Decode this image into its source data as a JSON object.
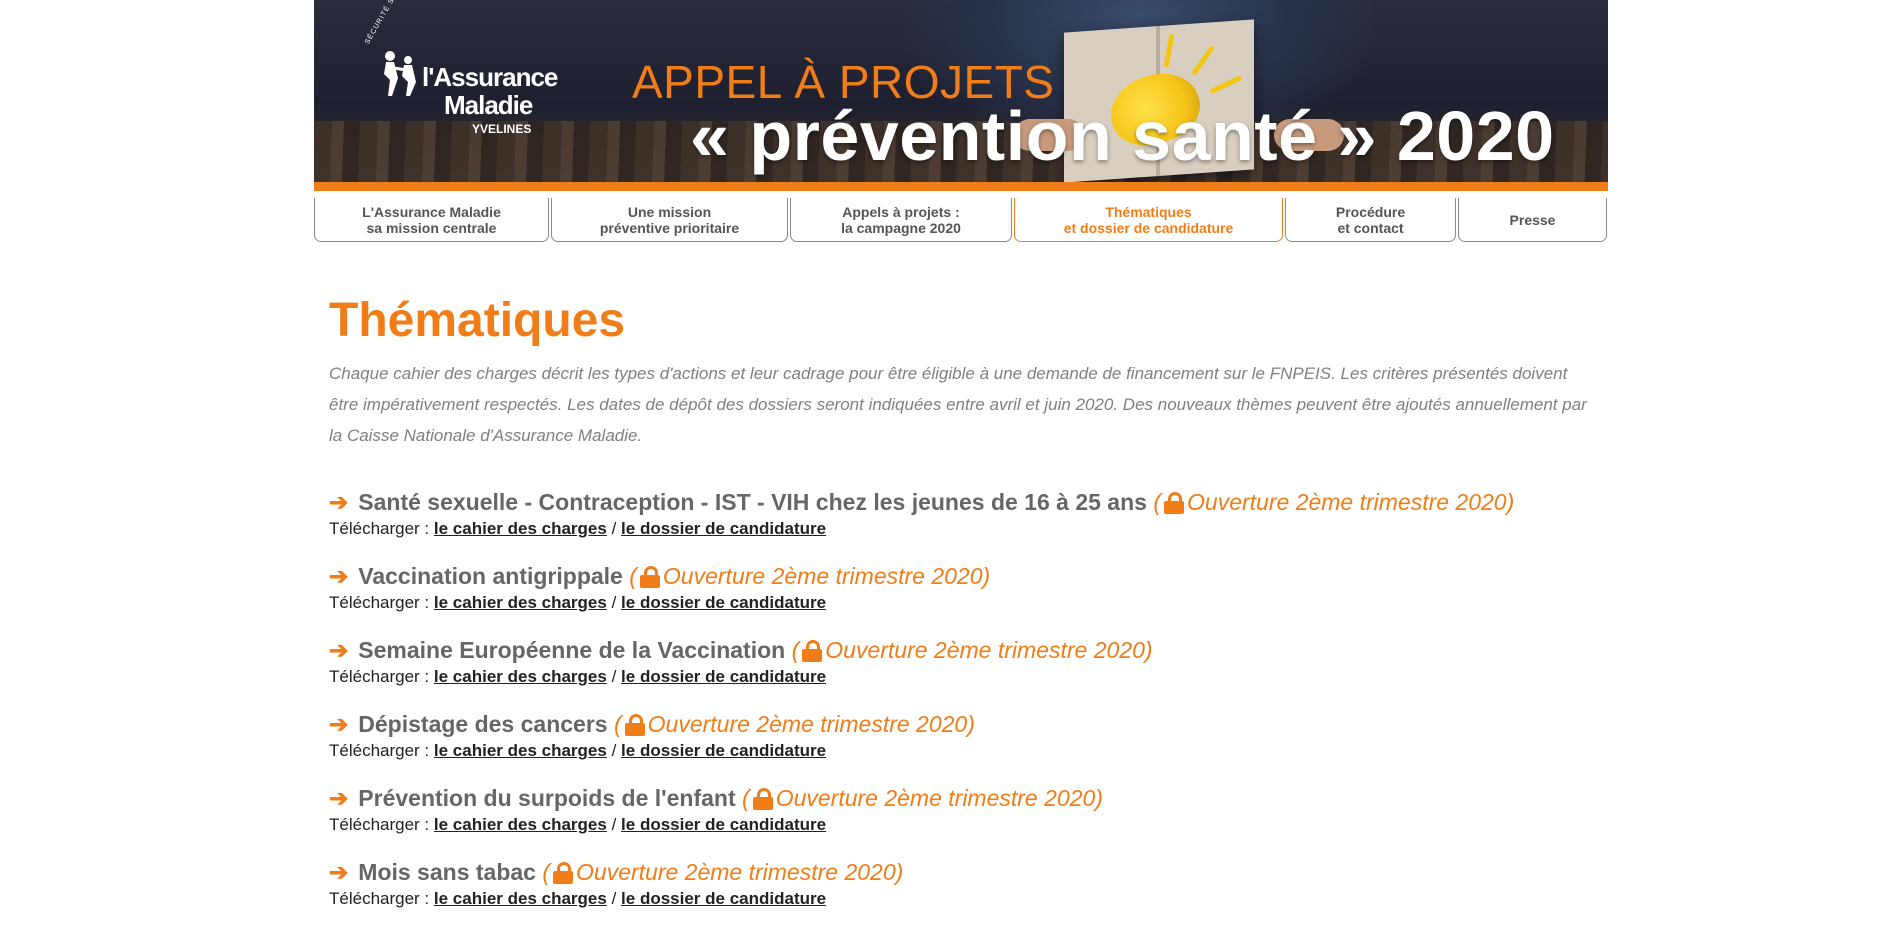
{
  "banner": {
    "logo_line1": "l'Assurance",
    "logo_line2": "Maladie",
    "logo_line3": "YVELINES",
    "logo_arc": "SÉCURITÉ SOCIALE",
    "headline_top": "APPEL À PROJETS",
    "headline_main": "« prévention santé » 2020"
  },
  "nav": {
    "tabs": [
      {
        "line1": "L'Assurance Maladie",
        "line2": "sa mission centrale"
      },
      {
        "line1": "Une mission",
        "line2": "préventive prioritaire"
      },
      {
        "line1": "Appels à projets :",
        "line2": "la campagne 2020"
      },
      {
        "line1": "Thématiques",
        "line2": "et dossier de candidature"
      },
      {
        "line1": "Procédure",
        "line2": "et contact"
      },
      {
        "line1": "Presse",
        "line2": ""
      }
    ],
    "active_index": 3
  },
  "main": {
    "title": "Thématiques",
    "intro": "Chaque cahier des charges décrit les types d'actions et leur cadrage pour être éligible à une demande de financement sur le FNPEIS. Les critères présentés doivent être impérativement respectés. Les dates de dépôt des dossiers seront indiquées entre avril et juin 2020. Des nouveaux thèmes peuvent être ajoutés annuellement par la Caisse Nationale d'Assurance Maladie.",
    "download_label": "Télécharger :",
    "link_cahier": "le cahier des charges",
    "separator": "/",
    "link_dossier": "le dossier de candidature",
    "status_open": "(",
    "status_text": "Ouverture 2ème trimestre 2020)",
    "themes": [
      {
        "name": "Santé sexuelle - Contraception - IST - VIH chez les jeunes de 16 à 25 ans"
      },
      {
        "name": "Vaccination antigrippale"
      },
      {
        "name": "Semaine Européenne de la Vaccination"
      },
      {
        "name": "Dépistage des cancers"
      },
      {
        "name": "Prévention du surpoids de l'enfant"
      },
      {
        "name": "Mois sans tabac"
      }
    ]
  },
  "colors": {
    "accent": "#f07d18",
    "text_grey": "#666666"
  },
  "icons": {
    "arrow": "right-arrow-icon",
    "lock": "lock-icon"
  }
}
